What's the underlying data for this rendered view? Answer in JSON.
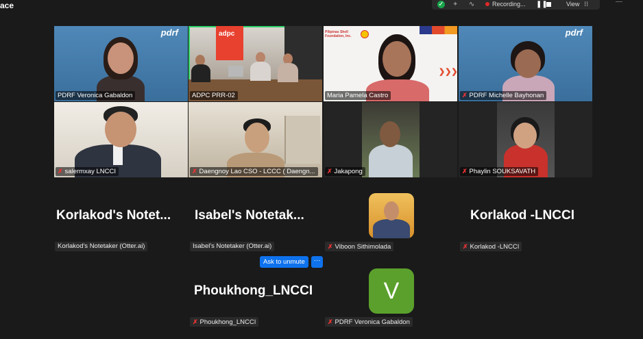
{
  "app": {
    "title": "ace"
  },
  "top_controls": {
    "recording_label": "Recording...",
    "view_label": "View",
    "icons": [
      "shield-check-icon",
      "sparkle-icon",
      "loop-icon",
      "pause-icon",
      "stop-icon",
      "grid-icon"
    ]
  },
  "video_tiles": [
    {
      "name": "PDRF Veronica Gabaldon",
      "muted": false,
      "active": false
    },
    {
      "name": "ADPC PRR-02",
      "muted": false,
      "active": true,
      "banner": "adpc"
    },
    {
      "name": "Maria Pamela Castro",
      "muted": false,
      "active": false,
      "banner_text": "Pilipinas Shell Foundation, Inc."
    },
    {
      "name": "PDRF Michelle Bayhonan",
      "muted": true,
      "active": false
    },
    {
      "name": "salermxay LNCCI",
      "muted": true,
      "active": false
    },
    {
      "name": "Daengnoy Lao CSO - LCCC ( Daengn...",
      "muted": true,
      "active": false
    },
    {
      "name": "Jakapong",
      "muted": true,
      "active": false
    },
    {
      "name": "Phaylin SOUKSAVATH",
      "muted": true,
      "active": false
    }
  ],
  "pdrf_logo": "pdrf",
  "name_tiles": [
    {
      "display": "Korlakod's  Notet...",
      "label": "Korlakod's Notetaker (Otter.ai)",
      "muted": false
    },
    {
      "display": "Isabel's  Notetak...",
      "label": "Isabel's Notetaker (Otter.ai)",
      "muted": false
    },
    {
      "display": "",
      "label": "Viboon Sithimolada",
      "muted": true
    },
    {
      "display": "Korlakod -LNCCI",
      "label": "Korlakod -LNCCI",
      "muted": true
    },
    {
      "display": "Phoukhong_LNCCI",
      "label": "Phoukhong_LNCCI",
      "muted": true
    },
    {
      "display": "",
      "label": "PDRF Veronica Gabaldon",
      "muted": true,
      "avatar_letter": "V",
      "avatar_color": "#5ba02c"
    }
  ],
  "actions": {
    "ask_to_unmute": "Ask to unmute",
    "more": "···"
  },
  "colors": {
    "accent": "#0e72ed",
    "active_speaker": "#2fd46a",
    "muted": "#e33333"
  }
}
